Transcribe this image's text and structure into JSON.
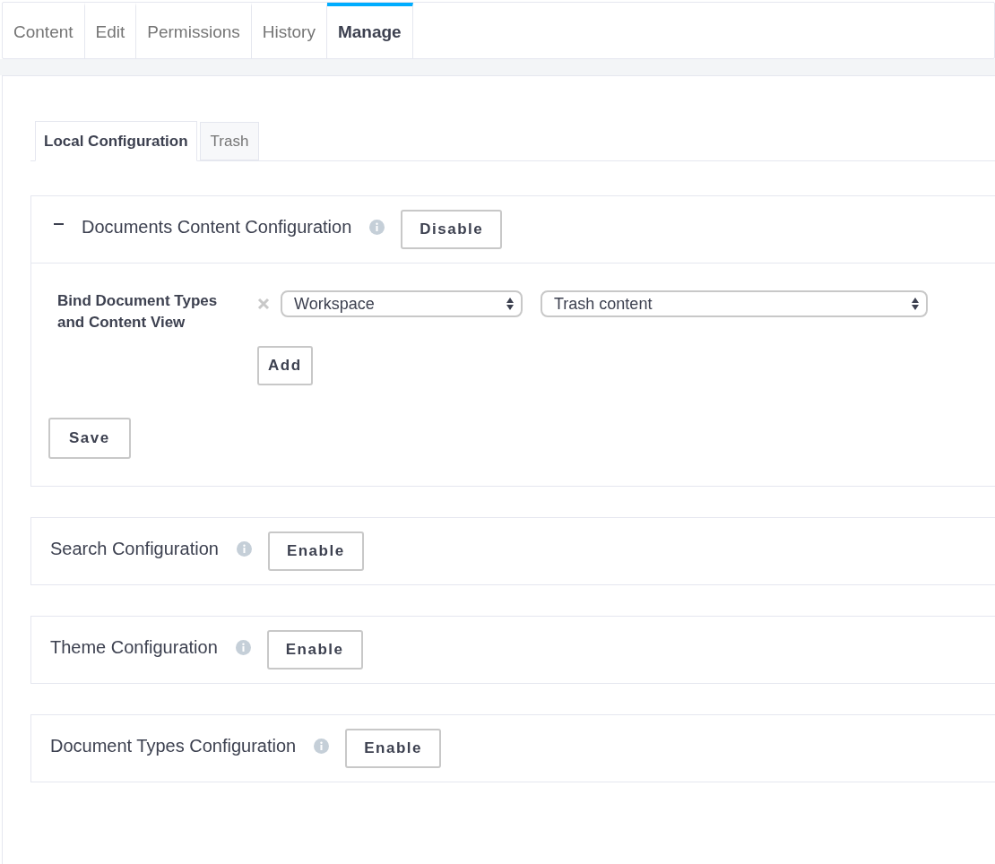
{
  "tabs": [
    {
      "label": "Content",
      "selected": false
    },
    {
      "label": "Edit",
      "selected": false
    },
    {
      "label": "Permissions",
      "selected": false
    },
    {
      "label": "History",
      "selected": false
    },
    {
      "label": "Manage",
      "selected": true
    }
  ],
  "subtabs": [
    {
      "label": "Local Configuration",
      "selected": true
    },
    {
      "label": "Trash",
      "selected": false
    }
  ],
  "sections": [
    {
      "title": "Documents Content Configuration",
      "expanded": true,
      "toggle_button": "Disable",
      "body": {
        "label": "Bind Document Types and Content View",
        "bindings": [
          {
            "selects": [
              {
                "value": "Workspace"
              },
              {
                "value": "Trash content"
              }
            ]
          }
        ],
        "add_button": "Add",
        "save_button": "Save"
      }
    },
    {
      "title": "Search Configuration",
      "expanded": false,
      "toggle_button": "Enable"
    },
    {
      "title": "Theme Configuration",
      "expanded": false,
      "toggle_button": "Enable"
    },
    {
      "title": "Document Types Configuration",
      "expanded": false,
      "toggle_button": "Enable"
    }
  ]
}
